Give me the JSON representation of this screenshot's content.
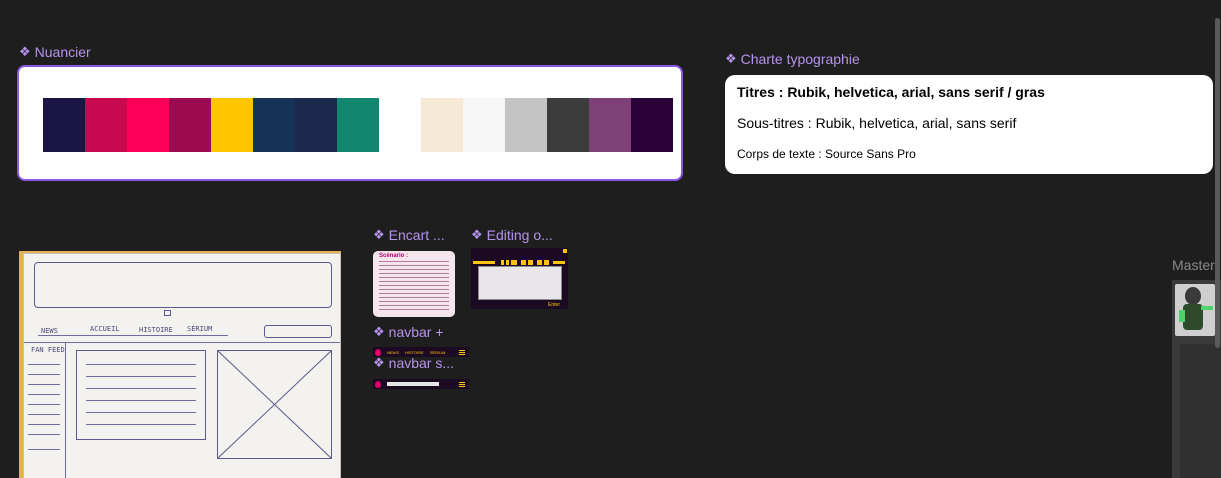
{
  "frames": {
    "nuancier": "Nuancier",
    "charte": "Charte typographie",
    "encart": "Encart ...",
    "editing": "Editing o...",
    "navbar_plus": "navbar +",
    "navbar_s": "navbar s...",
    "master": "Master"
  },
  "swatches": [
    "#1b1544",
    "#c8084f",
    "#ff0058",
    "#9c0a4f",
    "#ffc600",
    "#163255",
    "#1a294c",
    "#12876f",
    "#ffffff",
    "#f6ead7",
    "#f6f6f6",
    "#c4c4c4",
    "#3c3c3c",
    "#7f3f77",
    "#2b0237"
  ],
  "typo": {
    "titres": "Titres :  Rubik, helvetica, arial, sans serif / gras",
    "sous_titres": "Sous-titres : Rubik, helvetica, arial, sans serif",
    "corps": "Corps de texte : Source Sans Pro"
  },
  "sketch": {
    "nav": [
      "NEWS",
      "ACCUEIL",
      "HISTOIRE",
      "SÉRIUM"
    ],
    "fan_feed": "FAN FEED"
  },
  "encart": {
    "heading": "Scénario :"
  },
  "editing": {
    "enter": "Enter"
  },
  "navbar": {
    "items": [
      "NEWS",
      "HISTOIRE",
      "SÉRIUM"
    ]
  }
}
